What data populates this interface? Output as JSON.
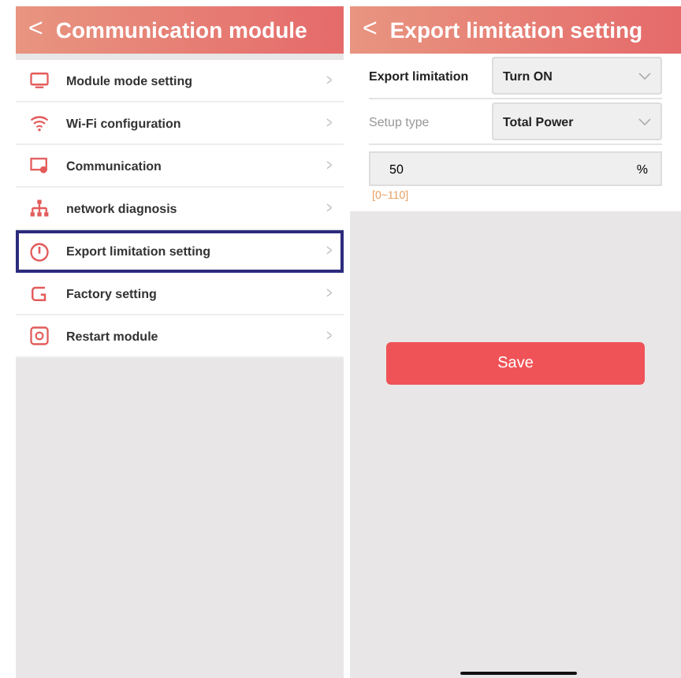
{
  "left_screen": {
    "header": {
      "back": "<",
      "title": "Communication module"
    },
    "items": [
      {
        "kind": "monitor",
        "label": "Module mode setting",
        "chevron": ">",
        "selected": false
      },
      {
        "kind": "wifi",
        "label": "Wi-Fi configuration",
        "chevron": ">",
        "selected": false
      },
      {
        "kind": "screen",
        "label": "Communication",
        "chevron": ">",
        "selected": false
      },
      {
        "kind": "network",
        "label": "network diagnosis",
        "chevron": ">",
        "selected": false
      },
      {
        "kind": "export",
        "label": "Export limitation setting",
        "chevron": ">",
        "selected": true
      },
      {
        "kind": "factory",
        "label": "Factory setting",
        "chevron": ">",
        "selected": false
      },
      {
        "kind": "restart",
        "label": "Restart module",
        "chevron": ">",
        "selected": false
      }
    ]
  },
  "right_screen": {
    "header": {
      "back": "<",
      "title": "Export limitation setting"
    },
    "fields": [
      {
        "label": "Export limitation",
        "value": "Turn ON",
        "dimmed": false
      },
      {
        "label": "Setup type",
        "value": "Total Power",
        "dimmed": true
      }
    ],
    "power_input": {
      "value": "50",
      "unit": "%",
      "hint": "[0~110]"
    },
    "save_button": "Save"
  }
}
